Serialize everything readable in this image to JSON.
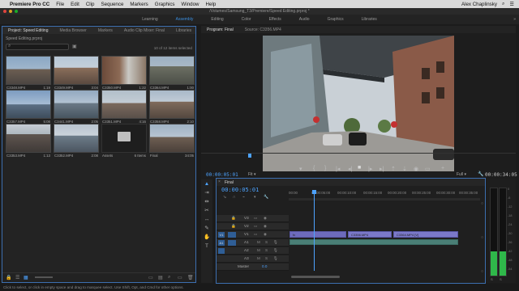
{
  "menubar": {
    "app": "Premiere Pro CC",
    "items": [
      "File",
      "Edit",
      "Clip",
      "Sequence",
      "Markers",
      "Graphics",
      "Window",
      "Help"
    ],
    "user": "Alex Chaplinsky"
  },
  "window_title": "/Volumes/Samsung_T3/Premiere/Speed Editing.prproj *",
  "workspaces": {
    "items": [
      "Learning",
      "Assembly",
      "Editing",
      "Color",
      "Effects",
      "Audio",
      "Graphics",
      "Libraries"
    ],
    "active": "Assembly",
    "more": "»"
  },
  "project": {
    "tabs": [
      "Project: Speed Editing",
      "Media Browser",
      "Markers",
      "Audio Clip Mixer: Final",
      "Libraries"
    ],
    "file": "Speed Editing.prproj",
    "count": "10 of 12 items selected",
    "clips": [
      {
        "name": "C3348.MP4",
        "dur": "1:19"
      },
      {
        "name": "C3349.MP4",
        "dur": "3:04"
      },
      {
        "name": "C3350.MP4",
        "dur": "1:22"
      },
      {
        "name": "C3364.MP4",
        "dur": "1:00"
      },
      {
        "name": "C3357.MP4",
        "dur": "5:08"
      },
      {
        "name": "C3441.MP4",
        "dur": "2:05"
      },
      {
        "name": "C3351.MP4",
        "dur": "4:16"
      },
      {
        "name": "C3358.MP4",
        "dur": "2:10"
      },
      {
        "name": "C3353.MP4",
        "dur": "1:13"
      },
      {
        "name": "C3352.MP4",
        "dur": "2:08"
      },
      {
        "name": "Assets",
        "dur": "6 Items"
      },
      {
        "name": "Final",
        "dur": "34:05"
      }
    ]
  },
  "program": {
    "tabs": [
      "Program: Final",
      "Source: C3356.MP4"
    ],
    "timecode_left": "00:00:05:01",
    "fit": "Fit",
    "resolution": "Full",
    "timecode_right": "00:00:34:05"
  },
  "timeline": {
    "tab": "Final",
    "timecode": "00:00:05:01",
    "ruler": [
      "00:00",
      "00:00:05:00",
      "00:00:10:00",
      "00:00:15:00",
      "00:00:20:00",
      "00:00:25:00",
      "00:00:30:00",
      "00:00:35:00"
    ],
    "tracks": [
      {
        "name": "V3",
        "kind": "video"
      },
      {
        "name": "V2",
        "kind": "video"
      },
      {
        "name": "V1",
        "kind": "video"
      },
      {
        "name": "A1",
        "kind": "audio"
      },
      {
        "name": "A2",
        "kind": "audio"
      },
      {
        "name": "A3",
        "kind": "audio"
      },
      {
        "name": "Master",
        "kind": "master",
        "value": "0.0"
      }
    ],
    "clips": [
      "C3356.MP4",
      "C3364.MP4 [V]"
    ]
  },
  "meters": {
    "scale": [
      "0",
      "-6",
      "-12",
      "-18",
      "-24",
      "-30",
      "-36",
      "-42",
      "-48",
      "-54"
    ]
  },
  "status": "Click to select, or click in empty space and drag to marquee select. Use Shift, Opt, and Cmd for other options.",
  "colors": {
    "accent": "#4da3ff",
    "video_clip": "#7b79c9",
    "audio_clip": "#4a7f76"
  }
}
